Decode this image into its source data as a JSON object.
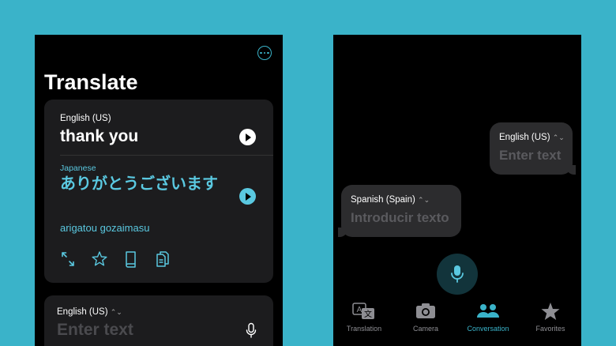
{
  "left_screen": {
    "title": "Translate",
    "result_card": {
      "source_language": "English (US)",
      "source_text": "thank you",
      "target_language": "Japanese",
      "target_text": "ありがとうございます",
      "target_romanization": "arigatou gozaimasu"
    },
    "input_card": {
      "language": "English (US)",
      "language_chevron": "⌃",
      "placeholder": "Enter text"
    }
  },
  "right_screen": {
    "bubble_english": {
      "language": "English (US)",
      "chevron": "⌃",
      "placeholder": "Enter text"
    },
    "bubble_spanish": {
      "language": "Spanish (Spain)",
      "chevron": "⌃",
      "placeholder": "Introducir texto"
    },
    "tabs": [
      {
        "label": "Translation",
        "icon": "translation-icon",
        "active": false
      },
      {
        "label": "Camera",
        "icon": "camera-icon",
        "active": false
      },
      {
        "label": "Conversation",
        "icon": "conversation-icon",
        "active": true
      },
      {
        "label": "Favorites",
        "icon": "star-icon",
        "active": false
      }
    ]
  },
  "colors": {
    "background": "#3ab3c9",
    "accent": "#5ac8e0",
    "card": "#1c1c1e",
    "bubble": "#2c2c2e"
  }
}
